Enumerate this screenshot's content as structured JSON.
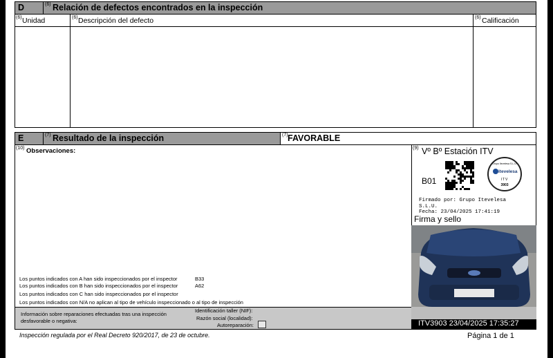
{
  "section_d": {
    "letter": "D",
    "sup": "(6)",
    "title": "Relación de defectos encontrados en la inspección",
    "col_unit_sup": "(6)",
    "col_unit": "Unidad",
    "col_desc_sup": "(6)",
    "col_desc": "Descripción del defecto",
    "col_grade_sup": "(6)",
    "col_grade": "Calificación"
  },
  "section_e": {
    "letter": "E",
    "sup": "(7)",
    "title": "Resultado de la inspección",
    "result_sup": "(7)",
    "result": "FAVORABLE",
    "obs_sup": "(10)",
    "obs_label": "Observaciones:"
  },
  "inspectors": [
    {
      "text": "Los puntos indicados con A han sido inspeccionados por el inspector",
      "code": "B33"
    },
    {
      "text": "Los puntos indicados con B han sido inspeccionados por el inspector",
      "code": "A62"
    },
    {
      "text": "Los puntos indicados con C han sido inspeccionados por el inspector",
      "code": ""
    },
    {
      "text": "Los puntos indicados con N/A no aplican al tipo de vehículo inspeccionado o al tipo de inspección",
      "code": ""
    }
  ],
  "repairs": {
    "info": "Información sobre reparaciones efectuadas tras una inspección desfavorable o negativa:",
    "nif": "Identificación taller (NIF):",
    "social": "Razón social (localidad):",
    "auto": "Autoreparación:"
  },
  "station": {
    "sup": "(9)",
    "title": "Vº Bº Estación ITV",
    "code": "B01",
    "stamp_top": "Grupo Itevelesa S.L.U.",
    "stamp_brand": "itevelesa",
    "stamp_itv": "ITV",
    "stamp_num": "3903",
    "signed_line1": "Firmado por: Grupo Itevelesa",
    "signed_line2": "S.L.U.",
    "signed_line3": "Fecha: 23/04/2025 17:41:19",
    "sign_label": "Firma y sello"
  },
  "photo": {
    "caption": "ITV3903 23/04/2025 17:35:27"
  },
  "footer": {
    "regulation": "Inspección regulada por el Real Decreto 920/2017, de 23 de octubre.",
    "page": "Página 1 de 1"
  }
}
